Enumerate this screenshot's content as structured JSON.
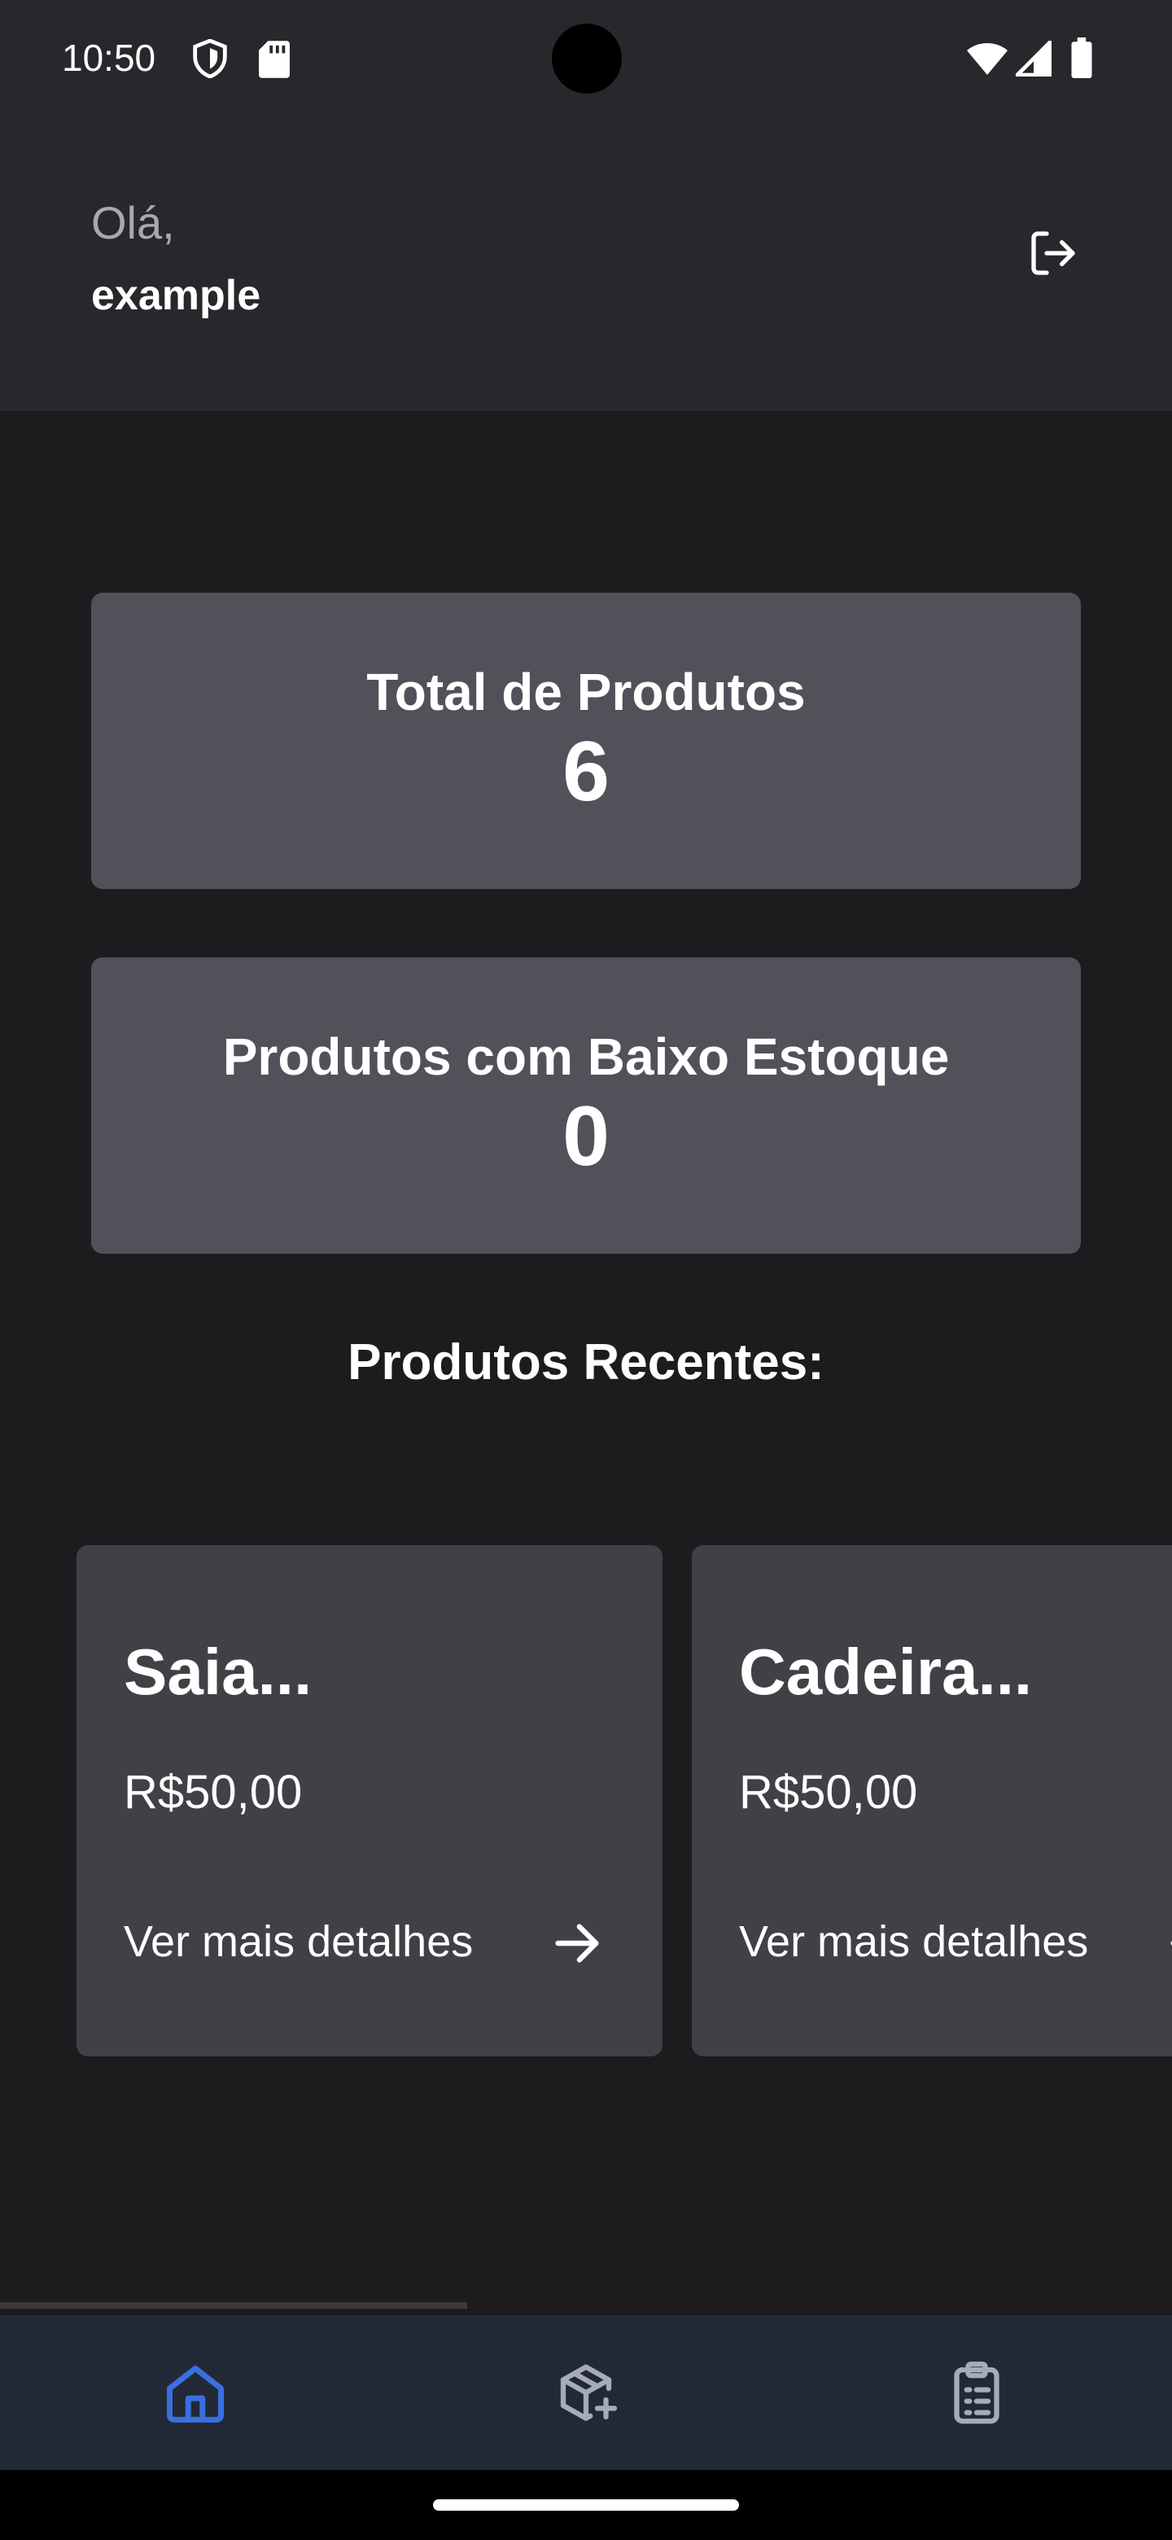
{
  "status_bar": {
    "time": "10:50",
    "icons": [
      "shield-icon",
      "sd-card-icon",
      "wifi-icon",
      "signal-icon",
      "battery-icon"
    ]
  },
  "header": {
    "greeting": "Olá,",
    "username": "example",
    "logout_icon": "logout-icon"
  },
  "stats": {
    "total_label": "Total de Produtos",
    "total_value": "6",
    "low_stock_label": "Produtos com Baixo Estoque",
    "low_stock_value": "0"
  },
  "recent": {
    "title": "Produtos Recentes:",
    "products": [
      {
        "name": "Saia...",
        "price": "R$50,00",
        "details": "Ver mais detalhes"
      },
      {
        "name": "Cadeira...",
        "price": "R$50,00",
        "details": "Ver mais detalhes"
      }
    ]
  },
  "bottom_nav": {
    "items": [
      {
        "icon": "home-icon",
        "active": true
      },
      {
        "icon": "add-product-icon",
        "active": false
      },
      {
        "icon": "clipboard-list-icon",
        "active": false
      }
    ]
  },
  "colors": {
    "background": "#1c1c1f",
    "header": "#28282c",
    "stat_card": "#515159",
    "product_card": "#404046",
    "nav_background": "#222936",
    "nav_active": "#3b6fe0",
    "nav_inactive": "#a6abb5"
  }
}
